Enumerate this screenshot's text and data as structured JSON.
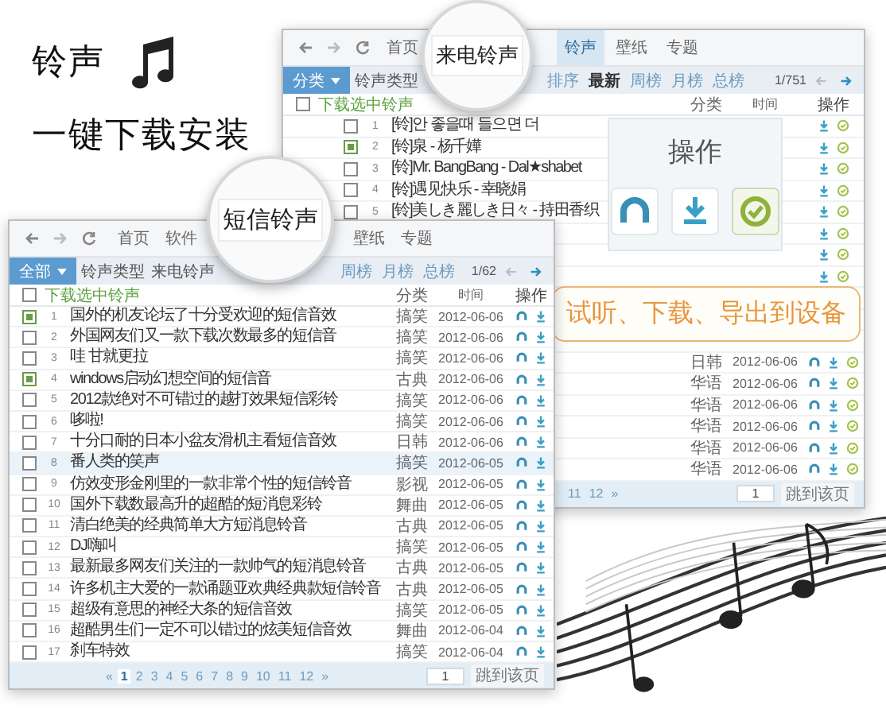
{
  "headline": {
    "title": "铃声",
    "subtitle": "一键下载安装"
  },
  "back_window": {
    "nav_tabs": [
      {
        "label": "首页",
        "selected": false
      },
      {
        "label": "铃声",
        "selected": true
      },
      {
        "label": "壁纸",
        "selected": false
      },
      {
        "label": "专题",
        "selected": false
      }
    ],
    "category_button": "分类",
    "filter": "铃声类型",
    "sort": [
      {
        "label": "排序",
        "selected": false
      },
      {
        "label": "最新",
        "selected": true
      },
      {
        "label": "周榜",
        "selected": false
      },
      {
        "label": "月榜",
        "selected": false
      },
      {
        "label": "总榜",
        "selected": false
      }
    ],
    "page": "1/751",
    "columns": {
      "select_all_checked": false,
      "download_selected": "下载选中铃声",
      "category": "分类",
      "time": "时间",
      "actions": "操作"
    },
    "rows": [
      {
        "kind": "title",
        "number": "1",
        "title": "[铃]안 좋을때 들으면 더",
        "checked": false
      },
      {
        "kind": "title",
        "number": "2",
        "title": "[铃]泉 - 杨千嬅",
        "checked": true
      },
      {
        "kind": "title",
        "number": "3",
        "title": "[铃]Mr. BangBang - Dal★shabet",
        "checked": false
      },
      {
        "kind": "title",
        "number": "4",
        "title": "[铃]遇见快乐 - 幸晓娟",
        "checked": false
      },
      {
        "kind": "title",
        "number": "5",
        "title": "[铃]美しき麗しき日々 - 持田香织",
        "checked": false
      },
      {
        "kind": "ops"
      },
      {
        "kind": "ops"
      },
      {
        "kind": "ops"
      },
      {
        "kind": "covered"
      },
      {
        "kind": "covered"
      },
      {
        "kind": "covered"
      },
      {
        "kind": "detail",
        "category": "日韩",
        "time": "2012-06-06"
      },
      {
        "kind": "detail",
        "category": "华语",
        "time": "2012-06-06"
      },
      {
        "kind": "detail",
        "category": "华语",
        "time": "2012-06-06"
      },
      {
        "kind": "detail",
        "category": "华语",
        "time": "2012-06-06"
      },
      {
        "kind": "detail",
        "category": "华语",
        "time": "2012-06-06"
      },
      {
        "kind": "detail",
        "category": "华语",
        "time": "2012-06-06"
      }
    ],
    "pages": [
      "11",
      "12",
      "»"
    ],
    "jump_input": "1",
    "jump_button": "跳到该页"
  },
  "magnifier_back": "来电铃声",
  "magnifier_front": "短信铃声",
  "actions_popup": {
    "title": "操作"
  },
  "callout": "试听、下载、导出到设备",
  "front_window": {
    "nav_tabs": [
      {
        "label": "首页",
        "selected": false
      },
      {
        "label": "软件",
        "selected": false
      },
      {
        "label": "壁纸",
        "selected": false
      },
      {
        "label": "专题",
        "selected": false
      }
    ],
    "category_button": "全部",
    "filters": [
      "铃声类型",
      "来电铃声"
    ],
    "sort": [
      {
        "label": "周榜",
        "selected": false
      },
      {
        "label": "月榜",
        "selected": false
      },
      {
        "label": "总榜",
        "selected": false
      }
    ],
    "page": "1/62",
    "columns": {
      "select_all_checked": false,
      "download_selected": "下载选中铃声",
      "category": "分类",
      "time": "时间",
      "actions": "操作"
    },
    "rows": [
      {
        "number": "1",
        "title": "国外的机友论坛了十分受欢迎的短信音效",
        "category": "搞笑",
        "time": "2012-06-06",
        "checked": true,
        "selected": false
      },
      {
        "number": "2",
        "title": "外国网友们又一款下载次数最多的短信音",
        "category": "搞笑",
        "time": "2012-06-06",
        "checked": false,
        "selected": false
      },
      {
        "number": "3",
        "title": "哇 甘就更拉",
        "category": "搞笑",
        "time": "2012-06-06",
        "checked": false,
        "selected": false
      },
      {
        "number": "4",
        "title": "windows启动幻想空间的短信音",
        "category": "古典",
        "time": "2012-06-06",
        "checked": true,
        "selected": false
      },
      {
        "number": "5",
        "title": "2012款绝对不可错过的越打效果短信彩铃",
        "category": "搞笑",
        "time": "2012-06-06",
        "checked": false,
        "selected": false
      },
      {
        "number": "6",
        "title": "哆啦!",
        "category": "搞笑",
        "time": "2012-06-06",
        "checked": false,
        "selected": false
      },
      {
        "number": "7",
        "title": "十分口耐的日本小盆友滑机主看短信音效",
        "category": "日韩",
        "time": "2012-06-06",
        "checked": false,
        "selected": false
      },
      {
        "number": "8",
        "title": "番人类的笑声",
        "category": "搞笑",
        "time": "2012-06-05",
        "checked": false,
        "selected": true
      },
      {
        "number": "9",
        "title": "仿效变形金刚里的一款非常个性的短信铃音",
        "category": "影视",
        "time": "2012-06-05",
        "checked": false,
        "selected": false
      },
      {
        "number": "10",
        "title": "国外下载数最高升的超酷的短消息彩铃",
        "category": "舞曲",
        "time": "2012-06-05",
        "checked": false,
        "selected": false
      },
      {
        "number": "11",
        "title": "清白绝美的经典简单大方短消息铃音",
        "category": "古典",
        "time": "2012-06-05",
        "checked": false,
        "selected": false
      },
      {
        "number": "12",
        "title": "DJ嗨叫",
        "category": "搞笑",
        "time": "2012-06-05",
        "checked": false,
        "selected": false
      },
      {
        "number": "13",
        "title": "最新最多网友们关注的一款帅气的短消息铃音",
        "category": "古典",
        "time": "2012-06-05",
        "checked": false,
        "selected": false
      },
      {
        "number": "14",
        "title": "许多机主大爱的一款诵题亚欢典经典款短信铃音",
        "category": "古典",
        "time": "2012-06-05",
        "checked": false,
        "selected": false
      },
      {
        "number": "15",
        "title": "超级有意思的神经大条的短信音效",
        "category": "搞笑",
        "time": "2012-06-05",
        "checked": false,
        "selected": false
      },
      {
        "number": "16",
        "title": "超酷男生们一定不可以错过的炫美短信音效",
        "category": "舞曲",
        "time": "2012-06-04",
        "checked": false,
        "selected": false
      },
      {
        "number": "17",
        "title": "刹车特效",
        "category": "搞笑",
        "time": "2012-06-04",
        "checked": false,
        "selected": false
      }
    ],
    "pages": [
      {
        "label": "«",
        "selected": false
      },
      {
        "label": "1",
        "selected": true
      },
      {
        "label": "2",
        "selected": false
      },
      {
        "label": "3",
        "selected": false
      },
      {
        "label": "4",
        "selected": false
      },
      {
        "label": "5",
        "selected": false
      },
      {
        "label": "6",
        "selected": false
      },
      {
        "label": "7",
        "selected": false
      },
      {
        "label": "8",
        "selected": false
      },
      {
        "label": "9",
        "selected": false
      },
      {
        "label": "10",
        "selected": false
      },
      {
        "label": "11",
        "selected": false
      },
      {
        "label": "12",
        "selected": false
      },
      {
        "label": "»",
        "selected": false
      }
    ],
    "jump_input": "1",
    "jump_button": "跳到该页"
  }
}
